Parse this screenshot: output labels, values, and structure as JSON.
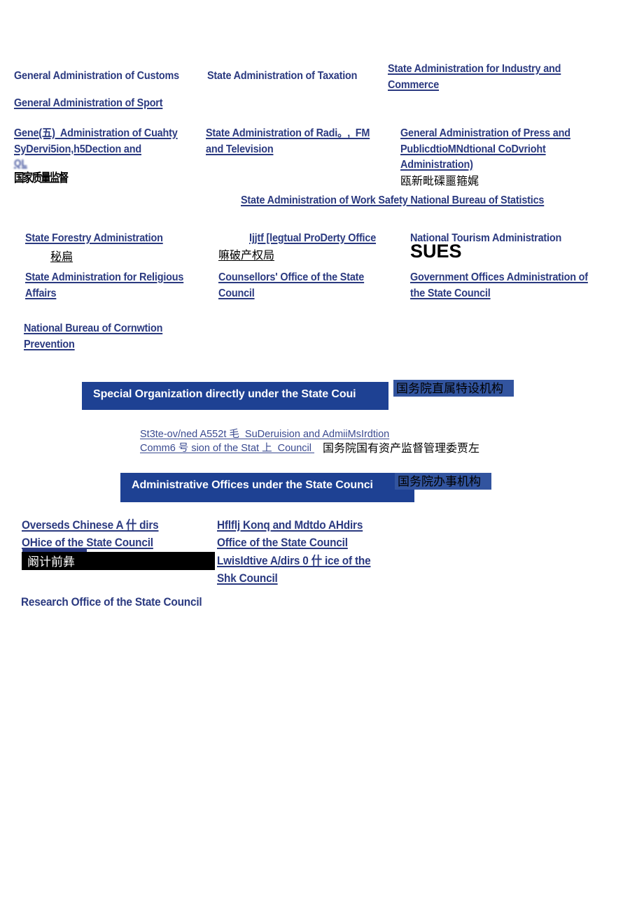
{
  "document": {
    "kind": "scanned-ocr-page",
    "colors": {
      "link_blue": "#2b3a80",
      "banner_blue": "#1e4193",
      "chip_blue": "#32549f",
      "black": "#000000",
      "white": "#ffffff"
    }
  },
  "agencies_top": {
    "customs": "General Administration of Customs",
    "taxation": "State Administration of Taxation",
    "industry_commerce": "State Administration for Industry and\nCommerce",
    "sport": "General Administration of Sport",
    "quality_supervision": "Gene(五)  Administration of Cuahty\nSyDervi5ion,h5Dection and",
    "quality_supervision_garbled_line": "QL",
    "quality_supervision_cn": "国家质量监督",
    "radio_film_tv": "State Administration of Radi。,  FM\nand Television",
    "press_publication": "General Administration of Press and\nPublicdtioMNdtional CoDvrioht\nAdministration)",
    "press_publication_cn": "瓯新毗磲噩箍娓",
    "work_safety_statistics": "State Administration of Work Safety National Bureau of Statistics"
  },
  "agencies_mid": {
    "forestry": "State Forestry Administration",
    "forestry_cn": "秘扁",
    "intellectual_property": "Ijjtf [legtual ProDerty Office",
    "intellectual_property_cn": "嘛破产权局",
    "tourism": "National Tourism Administration",
    "tourism_mark": "SUES",
    "religious_affairs": "State Administration for Religious\nAffairs",
    "counsellors_office": "Counsellors' Office of the State\nCouncil",
    "government_offices_admin": "Government Offices Administration of\nthe State Council",
    "corruption_prevention": "National Bureau of Cornwtion\nPrevention"
  },
  "special_section": {
    "banner_en": "Special Organization directly under the State Coui",
    "banner_cn": "国务院直属特设机构",
    "sasac_line1": "St3te-ov/ned A552t 毛  SuDeruision and AdmiiMsIrdtion",
    "sasac_line2_en": "Comm6 号 sion of the Stat 上  Council ",
    "sasac_line2_cn": "国务院国有资产监督管理委贾左"
  },
  "admin_offices_section": {
    "banner_en": "Administrative Offices under the State\nCounci",
    "banner_cn": "国务院办事机构",
    "overseas_chinese": "Overseds Chinese A 什 dirs\nOHice of the State Council",
    "overseas_chinese_cn": "阚计前彝",
    "hongkong_macao": "Hflflj Konq and Mdtdo AHdirs\nOffice of the State Council",
    "legislative_affairs": "LwisIdtive A/dirs 0 什 ice of the\nShk Council",
    "research_office": "Research Office of the State Council"
  }
}
